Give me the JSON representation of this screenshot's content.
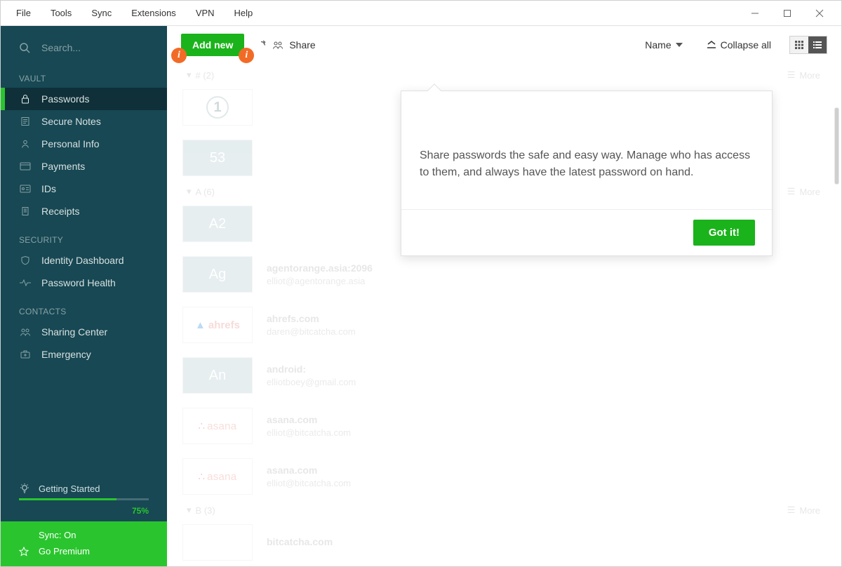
{
  "menubar": {
    "items": [
      "File",
      "Tools",
      "Sync",
      "Extensions",
      "VPN",
      "Help"
    ]
  },
  "sidebar": {
    "search_placeholder": "Search...",
    "sections": {
      "vault": {
        "title": "VAULT",
        "items": [
          {
            "label": "Passwords",
            "icon": "lock-icon",
            "active": true
          },
          {
            "label": "Secure Notes",
            "icon": "note-icon"
          },
          {
            "label": "Personal Info",
            "icon": "person-icon"
          },
          {
            "label": "Payments",
            "icon": "card-icon"
          },
          {
            "label": "IDs",
            "icon": "id-icon"
          },
          {
            "label": "Receipts",
            "icon": "receipt-icon"
          }
        ]
      },
      "security": {
        "title": "SECURITY",
        "items": [
          {
            "label": "Identity Dashboard",
            "icon": "shield-icon"
          },
          {
            "label": "Password Health",
            "icon": "pulse-icon"
          }
        ]
      },
      "contacts": {
        "title": "CONTACTS",
        "items": [
          {
            "label": "Sharing Center",
            "icon": "share-icon"
          },
          {
            "label": "Emergency",
            "icon": "firstaid-icon"
          }
        ]
      }
    },
    "getting_started": {
      "label": "Getting Started",
      "percent_label": "75%",
      "percent": 75
    },
    "footer": {
      "sync_label": "Sync: On",
      "premium_label": "Go Premium"
    }
  },
  "toolbar": {
    "add_new_label": "Add new",
    "share_label": "Share",
    "sort_label": "Name",
    "collapse_label": "Collapse all"
  },
  "popover": {
    "message": "Share passwords the safe and easy way. Manage who has access to them, and always have the latest password on hand.",
    "button": "Got it!"
  },
  "sections": [
    {
      "key": "hash",
      "header": "# (2)",
      "more": "More",
      "cards": [
        {
          "thumb": {
            "kind": "one"
          },
          "title": "",
          "sub": ""
        },
        {
          "thumb": {
            "kind": "text",
            "text": "53"
          },
          "title": "",
          "sub": ""
        }
      ]
    },
    {
      "key": "A",
      "header": "A (6)",
      "more": "More",
      "cards": [
        {
          "thumb": {
            "kind": "text",
            "text": "A2"
          },
          "title": "",
          "sub": ""
        },
        {
          "thumb": {
            "kind": "text",
            "text": "Ag"
          },
          "title": "agentorange.asia:2096",
          "sub": "elliot@agentorange.asia"
        },
        {
          "thumb": {
            "kind": "ahrefs"
          },
          "title": "ahrefs.com",
          "sub": "daren@bitcatcha.com"
        },
        {
          "thumb": {
            "kind": "text",
            "text": "An"
          },
          "title": "android:",
          "sub": "elliotboey@gmail.com"
        },
        {
          "thumb": {
            "kind": "asana"
          },
          "title": "asana.com",
          "sub": "elliot@bitcatcha.com"
        },
        {
          "thumb": {
            "kind": "asana"
          },
          "title": "asana.com",
          "sub": "elliot@bitcatcha.com"
        }
      ]
    },
    {
      "key": "B",
      "header": "B (3)",
      "more": "More",
      "cards": [
        {
          "thumb": {
            "kind": "blank"
          },
          "title": "bitcatcha.com",
          "sub": ""
        }
      ]
    }
  ]
}
